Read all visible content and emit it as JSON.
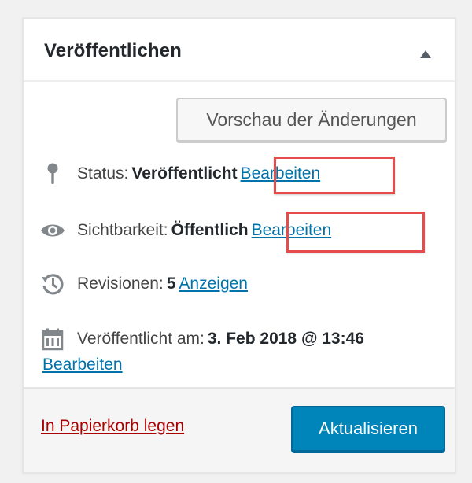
{
  "panel": {
    "title": "Veröffentlichen",
    "collapse_icon": "arrow-up-icon"
  },
  "preview_button": {
    "label": "Vorschau der Änderungen"
  },
  "status": {
    "icon": "pin-icon",
    "label": "Status:",
    "value": "Veröffentlicht",
    "link": "Bearbeiten"
  },
  "visibility": {
    "icon": "eye-icon",
    "label": "Sichtbarkeit:",
    "value": "Öffentlich",
    "link": "Bearbeiten"
  },
  "revisions": {
    "icon": "history-icon",
    "label": "Revisionen:",
    "value": "5",
    "link": "Anzeigen"
  },
  "published_date": {
    "icon": "calendar-icon",
    "label": "Veröffentlicht am:",
    "value": "3. Feb 2018 @ 13:46",
    "link": "Bearbeiten"
  },
  "footer": {
    "trash_link": "In Papierkorb legen",
    "update_button": "Aktualisieren"
  },
  "colors": {
    "link": "#0073aa",
    "trash": "#aa0000",
    "primary_button": "#0085ba",
    "highlight": "#e74c4c"
  }
}
